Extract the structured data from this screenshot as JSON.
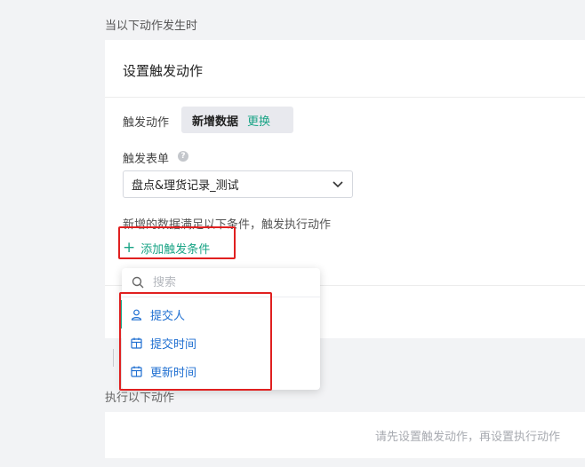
{
  "when_section_label": "当以下动作发生时",
  "card": {
    "title": "设置触发动作",
    "trigger_label": "触发动作",
    "trigger_value": "新增数据",
    "trigger_change": "更换",
    "form_label": "触发表单",
    "form_select_value": "盘点&理货记录_测试",
    "condition_text": "新增的数据满足以下条件，触发执行动作",
    "add_condition": "添加触发条件"
  },
  "dropdown": {
    "search_placeholder": "搜索",
    "items": [
      {
        "label": "提交人",
        "icon": "user-icon"
      },
      {
        "label": "提交时间",
        "icon": "calendar-icon"
      },
      {
        "label": "更新时间",
        "icon": "calendar-icon"
      }
    ]
  },
  "action_section_label": "执行以下动作",
  "action_card": {
    "placeholder": "请先设置触发动作，再设置执行动作"
  },
  "colors": {
    "accent": "#1aa486",
    "link_blue": "#1f6fd1",
    "highlight_red": "#e02020"
  }
}
